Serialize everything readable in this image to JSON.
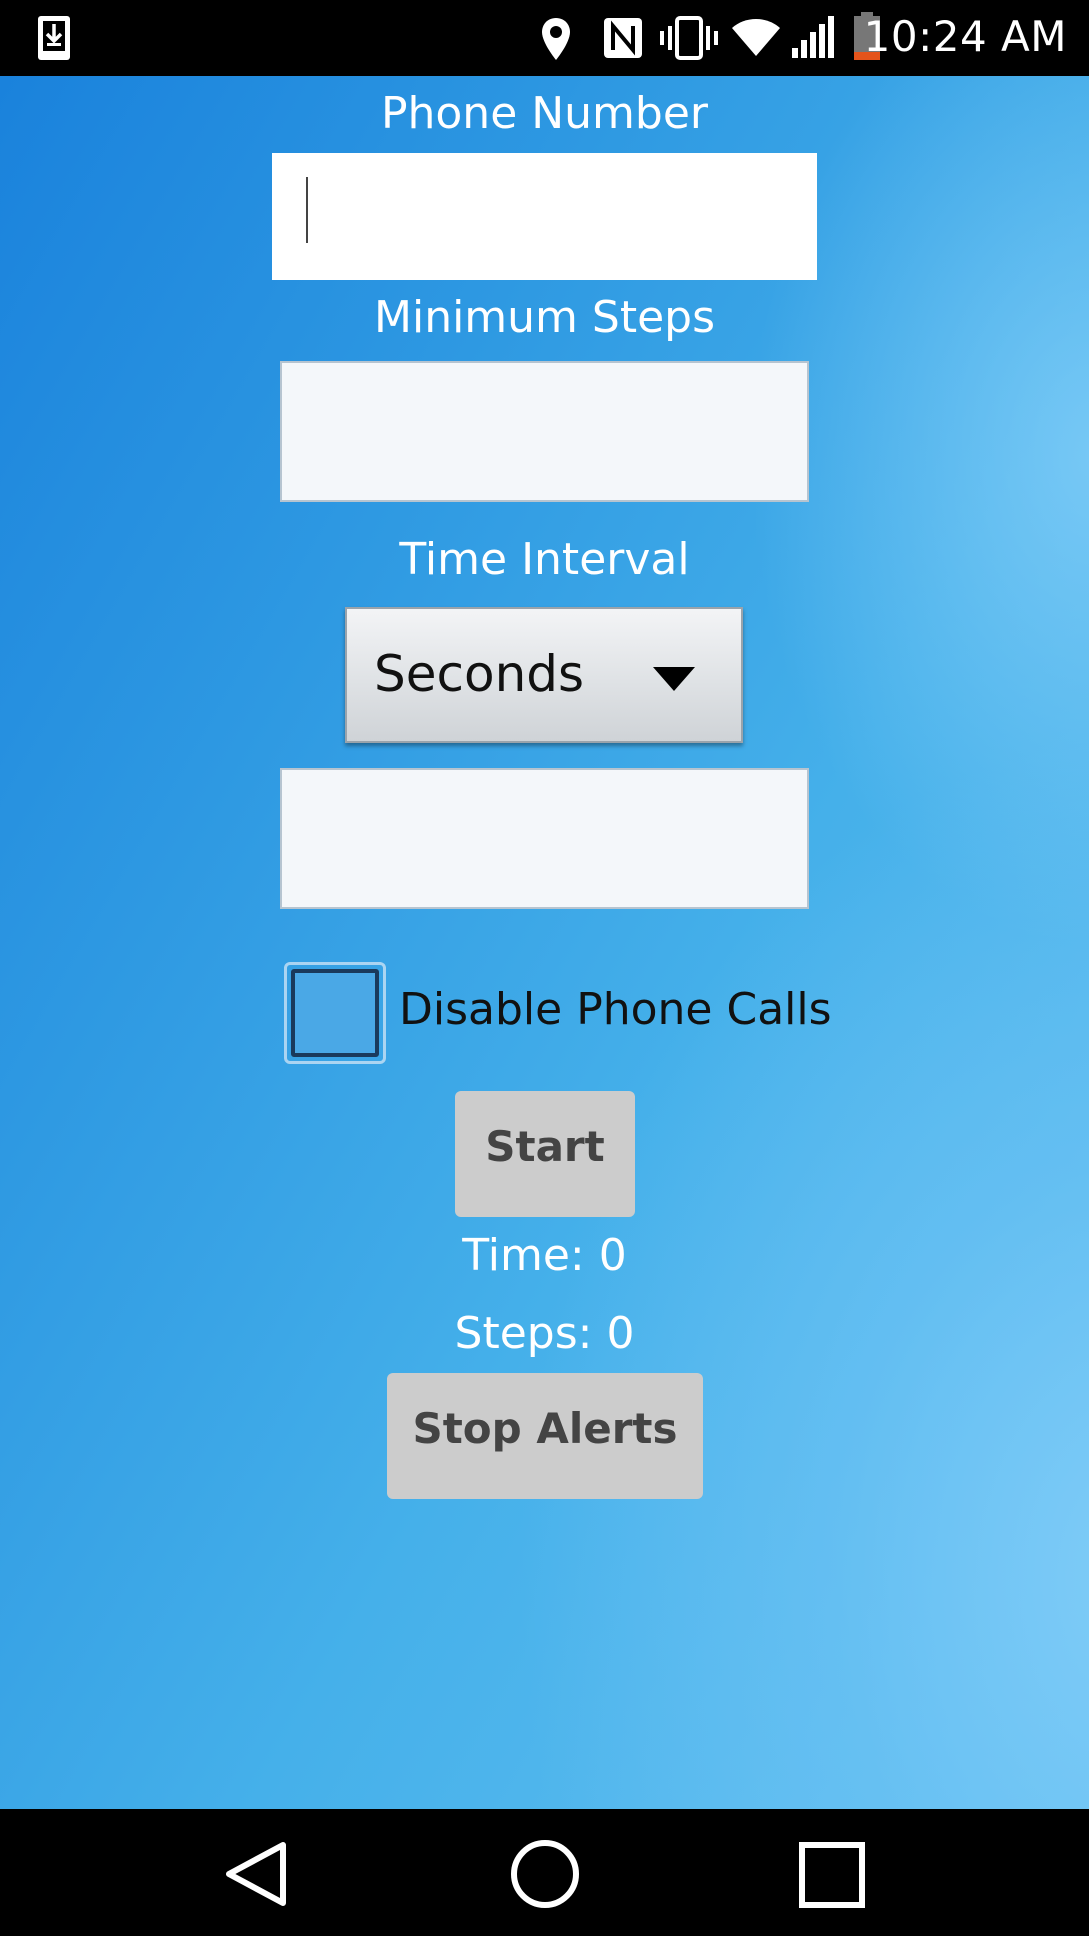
{
  "status_bar": {
    "time": "10:24 AM",
    "icons": [
      "download-notification-icon",
      "location-icon",
      "nfc-icon",
      "vibrate-icon",
      "wifi-icon",
      "cell-signal-icon",
      "battery-low-icon"
    ],
    "battery_color": "#e4541b"
  },
  "form": {
    "phone_label": "Phone Number",
    "phone_value": "",
    "steps_label": "Minimum Steps",
    "steps_value": "",
    "interval_label": "Time Interval",
    "interval_unit": "Seconds",
    "interval_value": "",
    "disable_calls_label": "Disable Phone Calls",
    "disable_calls_checked": false
  },
  "actions": {
    "start_label": "Start",
    "time_readout": "Time: 0",
    "steps_readout": "Steps: 0",
    "stop_alerts_label": "Stop Alerts"
  },
  "nav_bar": {
    "buttons": [
      "back-icon",
      "home-icon",
      "recents-icon"
    ]
  },
  "colors": {
    "background_start": "#1a82dc",
    "background_end": "#62c0f0",
    "button_bg": "#cccccc",
    "button_text": "#444444",
    "label_text": "#ffffff"
  }
}
